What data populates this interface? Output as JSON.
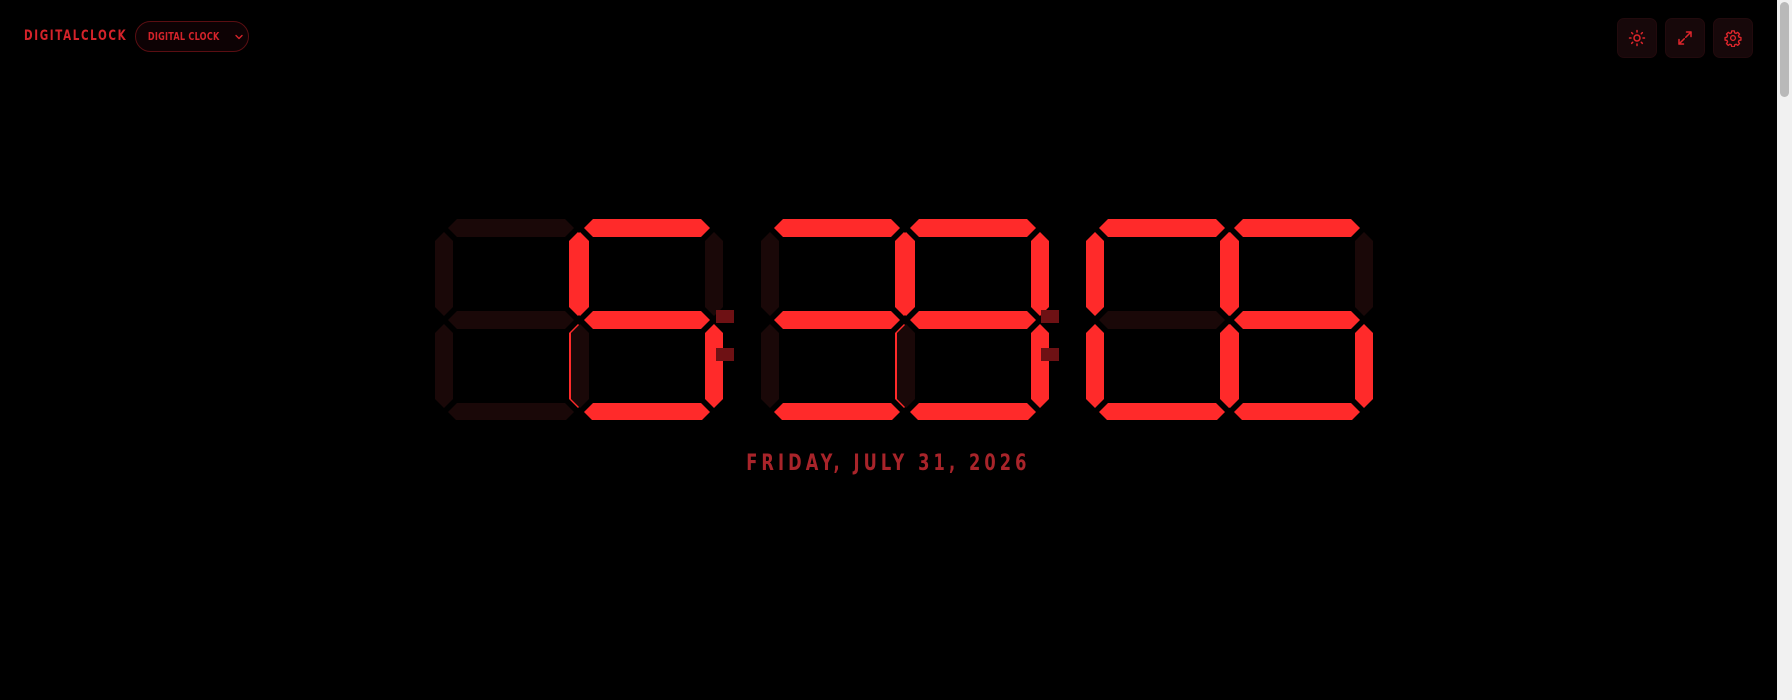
{
  "app": {
    "brand": "DIGITALCLOCK",
    "mode_label": "DIGITAL CLOCK"
  },
  "toolbar": {
    "brightness_icon": "sun-icon",
    "fullscreen_icon": "expand-icon",
    "settings_icon": "gear-icon"
  },
  "clock": {
    "time": "15:39:06",
    "hours": "15",
    "minutes": "39",
    "seconds": "06",
    "date": "FRIDAY, JULY 31, 2026"
  },
  "colors": {
    "background": "#000000",
    "segment_on": "#ff2a2a",
    "segment_off": "#1a0808",
    "accent": "#d4232a",
    "date": "#a8242a"
  }
}
